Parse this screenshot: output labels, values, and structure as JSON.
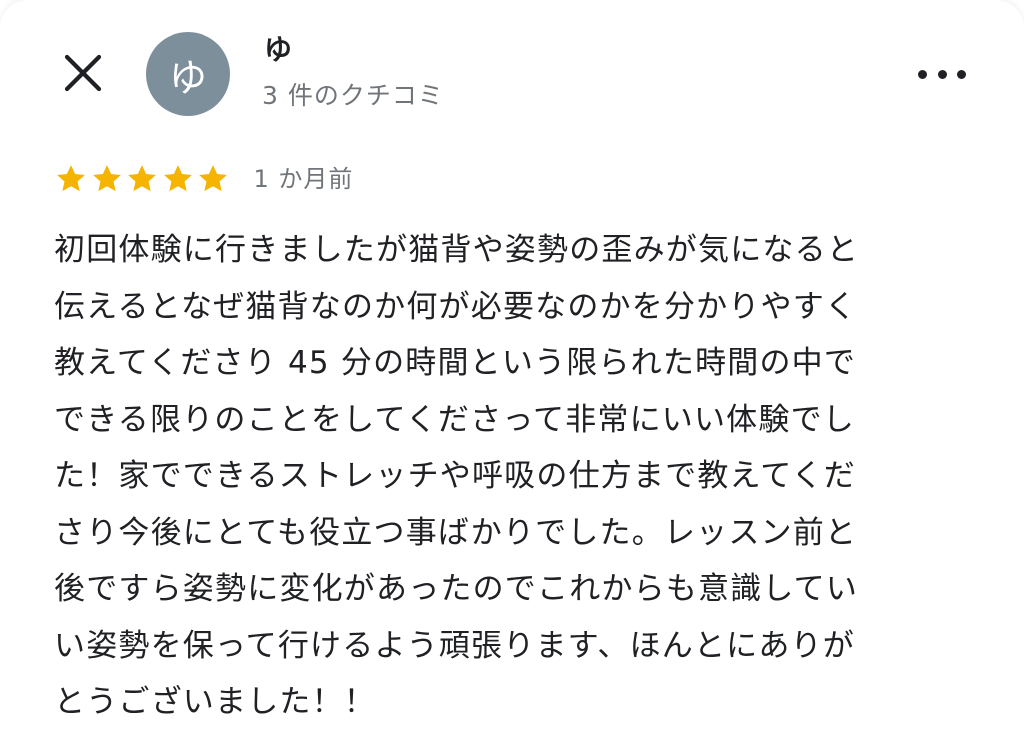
{
  "header": {
    "close_icon": "close-icon",
    "avatar_initial": "ゆ",
    "avatar_color": "#7e8f9c",
    "reviewer_name": "ゆ",
    "review_count": "3 件のクチコミ",
    "more_icon": "more-horizontal-icon"
  },
  "review": {
    "rating": 5,
    "max_rating": 5,
    "star_color": "#f4b400",
    "date": "1 か月前",
    "lines": [
      "初回体験に行きましたが猫背や姿勢の歪みが気になると",
      "伝えるとなぜ猫背なのか何が必要なのかを分かりやすく",
      "教えてくださり 45 分の時間という限られた時間の中で",
      "できる限りのことをしてくださって非常にいい体験でし",
      "た！家でできるストレッチや呼吸の仕方まで教えてくだ",
      "さり今後にとても役立つ事ばかりでした。レッスン前と",
      "後ですら姿勢に変化があったのでこれからも意識してい",
      "い姿勢を保って行けるよう頑張ります、ほんとにありが",
      "とうございました！！"
    ]
  }
}
